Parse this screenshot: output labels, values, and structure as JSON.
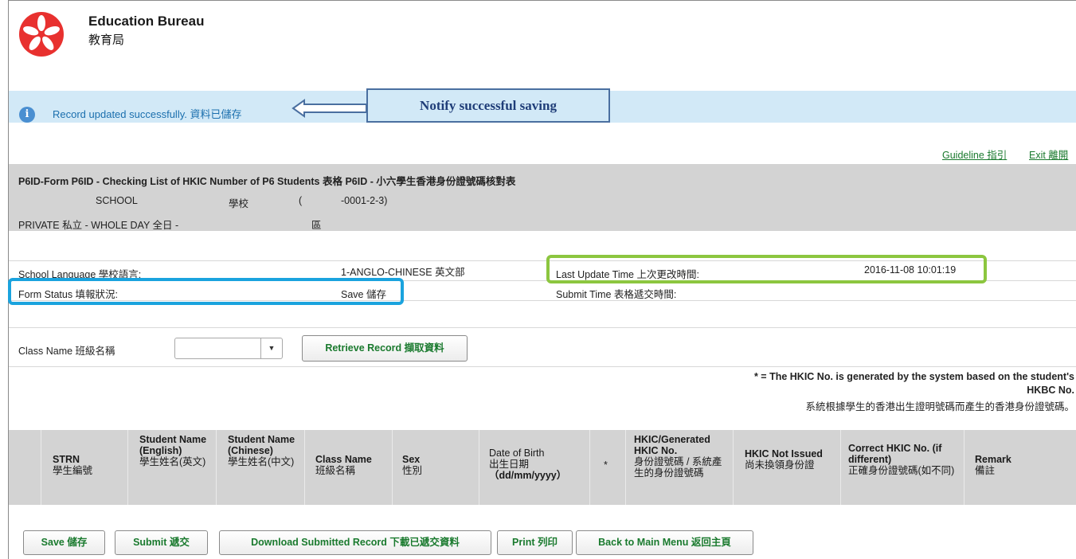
{
  "header": {
    "org_en": "Education Bureau",
    "org_zh": "教育局",
    "logo": "hksar-bauhinia-emblem"
  },
  "notification": {
    "icon": "info-icon",
    "message": "Record updated successfully. 資料已儲存",
    "annotation": "Notify successful saving"
  },
  "links": {
    "guideline": "Guideline 指引",
    "exit": "Exit 離開"
  },
  "form_header": {
    "title": "P6ID-Form P6ID - Checking List of HKIC Number of P6 Students 表格 P6ID - 小六學生香港身份證號碼核對表",
    "school_en": "SCHOOL",
    "school_zh": "學校",
    "school_paren": "(",
    "school_code": "-0001-2-3)",
    "school_type": "PRIVATE 私立 - WHOLE DAY 全日 -",
    "district": "區"
  },
  "info": {
    "language_label": "School Language 學校語言:",
    "language_value": "1-ANGLO-CHINESE 英文部",
    "last_update_label": "Last Update Time 上次更改時間:",
    "last_update_value": "2016-11-08 10:01:19",
    "status_label": "Form Status 填報狀況:",
    "status_value": "Save 儲存",
    "submit_time_label": "Submit Time 表格遞交時間:",
    "submit_time_value": ""
  },
  "filter": {
    "class_label": "Class Name 班級名稱",
    "class_value": "",
    "retrieve_button": "Retrieve Record 擷取資料"
  },
  "note": {
    "line1": "* = The HKIC No. is generated by the system based on the student's",
    "line2": "HKBC No.",
    "line3": "系統根據學生的香港出生證明號碼而產生的香港身份證號碼。"
  },
  "table": {
    "columns": [
      {
        "en": "STRN",
        "zh": "學生編號"
      },
      {
        "en": "Student Name (English)",
        "zh": "學生姓名(英文)"
      },
      {
        "en": "Student Name (Chinese)",
        "zh": "學生姓名(中文)"
      },
      {
        "en": "Class Name",
        "zh": "班級名稱"
      },
      {
        "en": "Sex",
        "zh": "性別"
      },
      {
        "en": "Date of Birth",
        "zh": "出生日期",
        "fmt": "（dd/mm/yyyy）"
      },
      {
        "en": "*",
        "zh": ""
      },
      {
        "en": "HKIC/Generated HKIC No.",
        "zh": "身份證號碼 / 系統產生的身份證號碼"
      },
      {
        "en": "HKIC Not Issued",
        "zh": "尚未換領身份證"
      },
      {
        "en": "Correct HKIC No. (if different)",
        "zh": "正確身份證號碼(如不同)"
      },
      {
        "en": "Remark",
        "zh": "備註"
      }
    ]
  },
  "actions": {
    "save": "Save 儲存",
    "submit": "Submit 遞交",
    "download": "Download Submitted Record 下載已遞交資料",
    "print": "Print 列印",
    "back": "Back to Main Menu 返回主頁"
  },
  "colors": {
    "accent_green": "#1a7a2e",
    "notify_bg": "#d2e9f7",
    "highlight_green": "#8cc63f",
    "highlight_blue": "#1aa3de"
  }
}
